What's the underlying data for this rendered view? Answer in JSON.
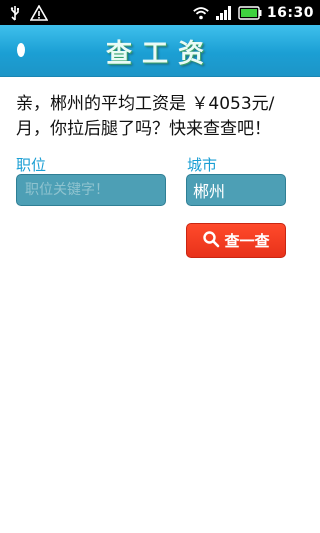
{
  "statusbar": {
    "time": "16:30",
    "icons": [
      "usb-icon",
      "warning-icon",
      "wifi-icon",
      "signal-icon",
      "battery-icon"
    ]
  },
  "titlebar": {
    "title": "查工资"
  },
  "intro": {
    "text": "亲，郴州的平均工资是 ￥4053元/月，你拉后腿了吗？快来查查吧！"
  },
  "form": {
    "job_label": "职位",
    "job_placeholder": "职位关键字！",
    "city_label": "城市",
    "city_value": "郴州",
    "search_label": "查一查"
  },
  "colors": {
    "accent": "#1b9fd4",
    "button": "#e8321a",
    "field": "#4d9fb5"
  }
}
